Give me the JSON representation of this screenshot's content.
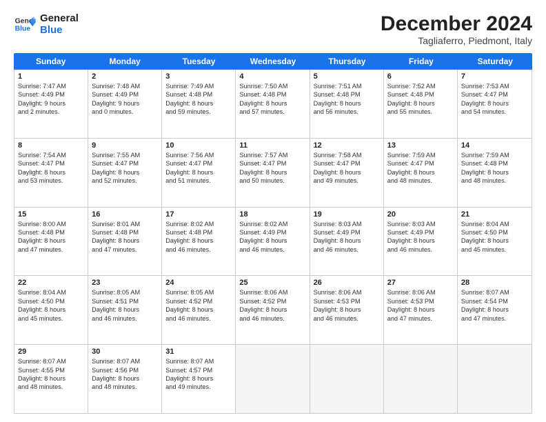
{
  "logo": {
    "line1": "General",
    "line2": "Blue"
  },
  "title": "December 2024",
  "subtitle": "Tagliaferro, Piedmont, Italy",
  "header_days": [
    "Sunday",
    "Monday",
    "Tuesday",
    "Wednesday",
    "Thursday",
    "Friday",
    "Saturday"
  ],
  "rows": [
    [
      {
        "day": "1",
        "info": "Sunrise: 7:47 AM\nSunset: 4:49 PM\nDaylight: 9 hours\nand 2 minutes."
      },
      {
        "day": "2",
        "info": "Sunrise: 7:48 AM\nSunset: 4:49 PM\nDaylight: 9 hours\nand 0 minutes."
      },
      {
        "day": "3",
        "info": "Sunrise: 7:49 AM\nSunset: 4:48 PM\nDaylight: 8 hours\nand 59 minutes."
      },
      {
        "day": "4",
        "info": "Sunrise: 7:50 AM\nSunset: 4:48 PM\nDaylight: 8 hours\nand 57 minutes."
      },
      {
        "day": "5",
        "info": "Sunrise: 7:51 AM\nSunset: 4:48 PM\nDaylight: 8 hours\nand 56 minutes."
      },
      {
        "day": "6",
        "info": "Sunrise: 7:52 AM\nSunset: 4:48 PM\nDaylight: 8 hours\nand 55 minutes."
      },
      {
        "day": "7",
        "info": "Sunrise: 7:53 AM\nSunset: 4:47 PM\nDaylight: 8 hours\nand 54 minutes."
      }
    ],
    [
      {
        "day": "8",
        "info": "Sunrise: 7:54 AM\nSunset: 4:47 PM\nDaylight: 8 hours\nand 53 minutes."
      },
      {
        "day": "9",
        "info": "Sunrise: 7:55 AM\nSunset: 4:47 PM\nDaylight: 8 hours\nand 52 minutes."
      },
      {
        "day": "10",
        "info": "Sunrise: 7:56 AM\nSunset: 4:47 PM\nDaylight: 8 hours\nand 51 minutes."
      },
      {
        "day": "11",
        "info": "Sunrise: 7:57 AM\nSunset: 4:47 PM\nDaylight: 8 hours\nand 50 minutes."
      },
      {
        "day": "12",
        "info": "Sunrise: 7:58 AM\nSunset: 4:47 PM\nDaylight: 8 hours\nand 49 minutes."
      },
      {
        "day": "13",
        "info": "Sunrise: 7:59 AM\nSunset: 4:47 PM\nDaylight: 8 hours\nand 48 minutes."
      },
      {
        "day": "14",
        "info": "Sunrise: 7:59 AM\nSunset: 4:48 PM\nDaylight: 8 hours\nand 48 minutes."
      }
    ],
    [
      {
        "day": "15",
        "info": "Sunrise: 8:00 AM\nSunset: 4:48 PM\nDaylight: 8 hours\nand 47 minutes."
      },
      {
        "day": "16",
        "info": "Sunrise: 8:01 AM\nSunset: 4:48 PM\nDaylight: 8 hours\nand 47 minutes."
      },
      {
        "day": "17",
        "info": "Sunrise: 8:02 AM\nSunset: 4:48 PM\nDaylight: 8 hours\nand 46 minutes."
      },
      {
        "day": "18",
        "info": "Sunrise: 8:02 AM\nSunset: 4:49 PM\nDaylight: 8 hours\nand 46 minutes."
      },
      {
        "day": "19",
        "info": "Sunrise: 8:03 AM\nSunset: 4:49 PM\nDaylight: 8 hours\nand 46 minutes."
      },
      {
        "day": "20",
        "info": "Sunrise: 8:03 AM\nSunset: 4:49 PM\nDaylight: 8 hours\nand 46 minutes."
      },
      {
        "day": "21",
        "info": "Sunrise: 8:04 AM\nSunset: 4:50 PM\nDaylight: 8 hours\nand 45 minutes."
      }
    ],
    [
      {
        "day": "22",
        "info": "Sunrise: 8:04 AM\nSunset: 4:50 PM\nDaylight: 8 hours\nand 45 minutes."
      },
      {
        "day": "23",
        "info": "Sunrise: 8:05 AM\nSunset: 4:51 PM\nDaylight: 8 hours\nand 46 minutes."
      },
      {
        "day": "24",
        "info": "Sunrise: 8:05 AM\nSunset: 4:52 PM\nDaylight: 8 hours\nand 46 minutes."
      },
      {
        "day": "25",
        "info": "Sunrise: 8:06 AM\nSunset: 4:52 PM\nDaylight: 8 hours\nand 46 minutes."
      },
      {
        "day": "26",
        "info": "Sunrise: 8:06 AM\nSunset: 4:53 PM\nDaylight: 8 hours\nand 46 minutes."
      },
      {
        "day": "27",
        "info": "Sunrise: 8:06 AM\nSunset: 4:53 PM\nDaylight: 8 hours\nand 47 minutes."
      },
      {
        "day": "28",
        "info": "Sunrise: 8:07 AM\nSunset: 4:54 PM\nDaylight: 8 hours\nand 47 minutes."
      }
    ],
    [
      {
        "day": "29",
        "info": "Sunrise: 8:07 AM\nSunset: 4:55 PM\nDaylight: 8 hours\nand 48 minutes."
      },
      {
        "day": "30",
        "info": "Sunrise: 8:07 AM\nSunset: 4:56 PM\nDaylight: 8 hours\nand 48 minutes."
      },
      {
        "day": "31",
        "info": "Sunrise: 8:07 AM\nSunset: 4:57 PM\nDaylight: 8 hours\nand 49 minutes."
      },
      {
        "day": "",
        "info": ""
      },
      {
        "day": "",
        "info": ""
      },
      {
        "day": "",
        "info": ""
      },
      {
        "day": "",
        "info": ""
      }
    ]
  ]
}
